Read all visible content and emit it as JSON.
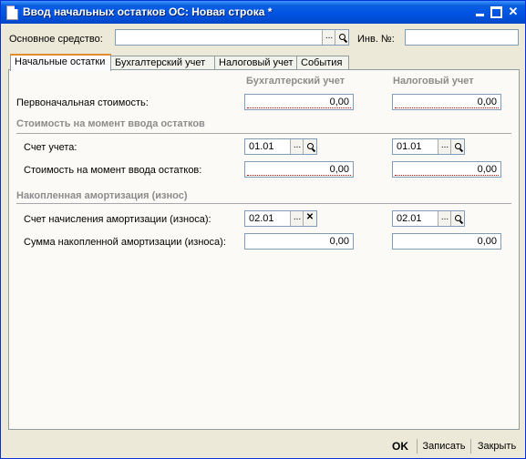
{
  "window": {
    "title": "Ввод начальных остатков ОС: Новая строка *"
  },
  "header": {
    "asset_label": "Основное средство:",
    "asset_value": "",
    "inv_label": "Инв. №:",
    "inv_value": "",
    "select_button": "...",
    "open_button": "open-icon"
  },
  "tabs": [
    {
      "label": "Начальные остатки",
      "active": true
    },
    {
      "label": "Бухгалтерский учет",
      "active": false
    },
    {
      "label": "Налоговый учет",
      "active": false
    },
    {
      "label": "События",
      "active": false
    }
  ],
  "columns": {
    "accounting": "Бухгалтерский учет",
    "tax": "Налоговый учет"
  },
  "initial_cost": {
    "label": "Первоначальная стоимость:",
    "accounting": "0,00",
    "tax": "0,00"
  },
  "section_cost": {
    "title": "Стоимость на момент ввода остатков",
    "account_label": "Счет учета:",
    "account_accounting": "01.01",
    "account_tax": "01.01",
    "cost_label": "Стоимость на момент ввода остатков:",
    "cost_accounting": "0,00",
    "cost_tax": "0,00"
  },
  "section_depreciation": {
    "title": "Накопленная амортизация (износ)",
    "account_label": "Счет начисления амортизации (износа):",
    "account_accounting": "02.01",
    "account_tax": "02.01",
    "sum_label": "Сумма накопленной амортизации (износа):",
    "sum_accounting": "0,00",
    "sum_tax": "0,00"
  },
  "footer": {
    "ok": "OK",
    "save": "Записать",
    "close": "Закрыть"
  }
}
